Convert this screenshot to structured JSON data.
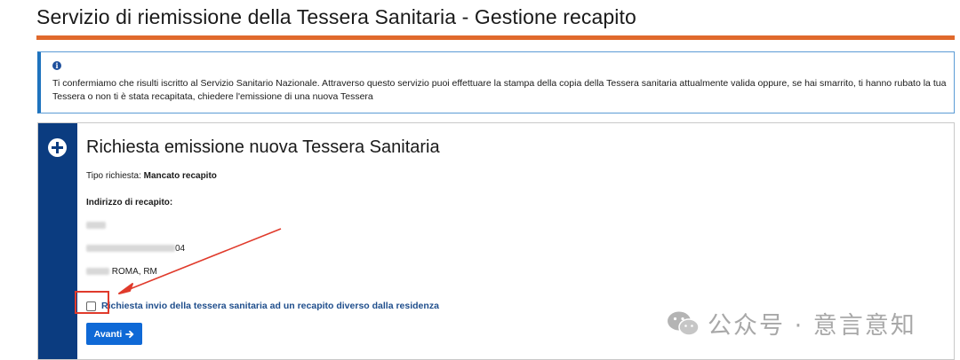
{
  "page": {
    "title": "Servizio di riemissione della Tessera Sanitaria - Gestione recapito"
  },
  "info": {
    "icon": "info-icon",
    "text": "Ti confermiamo che risulti iscritto al Servizio Sanitario Nazionale. Attraverso questo servizio puoi effettuare la stampa della copia della Tessera sanitaria attualmente valida oppure, se hai smarrito, ti hanno rubato la tua Tessera o non ti è stata recapitata, chiedere l'emissione di una nuova Tessera"
  },
  "card": {
    "icon": "plus-circle-icon",
    "title": "Richiesta emissione nuova Tessera Sanitaria",
    "request_type_label": "Tipo richiesta: ",
    "request_type_value": "Mancato recapito",
    "address_label": "Indirizzo di recapito:",
    "address_line2_visible": "04",
    "address_line3_visible": "ROMA, RM",
    "checkbox_label": "Richiesta invio della tessera sanitaria ad un recapito diverso dalla residenza",
    "checkbox_checked": false,
    "button_label": "Avanti"
  },
  "annotation": {
    "highlight_color": "#e03a2b"
  },
  "colors": {
    "accent_orange": "#e0692c",
    "sidebar_navy": "#0b3c80",
    "button_blue": "#0f69d6",
    "link_blue": "#1f4e8c"
  },
  "watermark": {
    "text": "公众号 · 意言意知",
    "icon": "wechat-icon"
  }
}
